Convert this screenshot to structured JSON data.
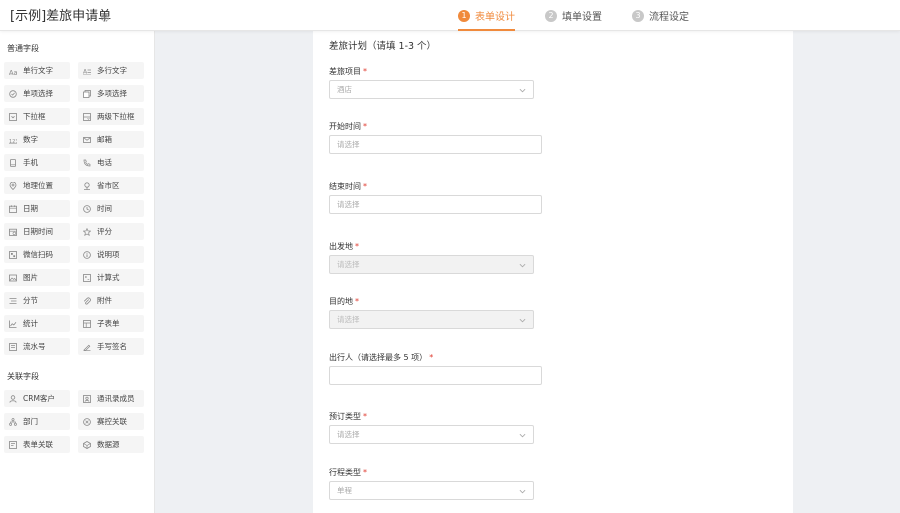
{
  "header": {
    "title": "[示例]差旅申请单",
    "steps": [
      {
        "num": "1",
        "label": "表单设计"
      },
      {
        "num": "2",
        "label": "填单设置"
      },
      {
        "num": "3",
        "label": "流程设定"
      }
    ],
    "active_step": 0,
    "accent_color": "#f08a3c"
  },
  "sidebar": {
    "common_title": "普通字段",
    "common": [
      {
        "label": "单行文字",
        "icon": "text-icon"
      },
      {
        "label": "多行文字",
        "icon": "multiline-text-icon"
      },
      {
        "label": "单项选择",
        "icon": "radio-icon"
      },
      {
        "label": "多项选择",
        "icon": "checkbox-icon"
      },
      {
        "label": "下拉框",
        "icon": "dropdown-icon"
      },
      {
        "label": "两级下拉框",
        "icon": "cascade-dropdown-icon"
      },
      {
        "label": "数字",
        "icon": "number-icon"
      },
      {
        "label": "邮箱",
        "icon": "mail-icon"
      },
      {
        "label": "手机",
        "icon": "mobile-icon"
      },
      {
        "label": "电话",
        "icon": "phone-icon"
      },
      {
        "label": "地理位置",
        "icon": "location-icon"
      },
      {
        "label": "省市区",
        "icon": "region-icon"
      },
      {
        "label": "日期",
        "icon": "calendar-icon"
      },
      {
        "label": "时间",
        "icon": "clock-icon"
      },
      {
        "label": "日期时间",
        "icon": "datetime-icon"
      },
      {
        "label": "评分",
        "icon": "star-icon"
      },
      {
        "label": "微信扫码",
        "icon": "qrcode-icon"
      },
      {
        "label": "说明项",
        "icon": "info-icon"
      },
      {
        "label": "图片",
        "icon": "image-icon"
      },
      {
        "label": "计算式",
        "icon": "formula-icon"
      },
      {
        "label": "分节",
        "icon": "section-icon"
      },
      {
        "label": "附件",
        "icon": "attachment-icon"
      },
      {
        "label": "统计",
        "icon": "chart-icon"
      },
      {
        "label": "子表单",
        "icon": "subform-icon"
      },
      {
        "label": "流水号",
        "icon": "serial-icon"
      },
      {
        "label": "手写签名",
        "icon": "signature-icon"
      }
    ],
    "related_title": "关联字段",
    "related": [
      {
        "label": "CRM客户",
        "icon": "customer-icon"
      },
      {
        "label": "通讯录成员",
        "icon": "contacts-icon"
      },
      {
        "label": "部门",
        "icon": "department-icon"
      },
      {
        "label": "赛控关联",
        "icon": "link-icon"
      },
      {
        "label": "表单关联",
        "icon": "form-link-icon"
      },
      {
        "label": "数据源",
        "icon": "datasource-icon"
      }
    ]
  },
  "form": {
    "title": "差旅计划（请填 1-3 个）",
    "fields": [
      {
        "label": "差旅项目",
        "type": "select",
        "value": "酒店",
        "disabled": false
      },
      {
        "label": "开始时间",
        "type": "input",
        "value": "请选择",
        "disabled": false
      },
      {
        "label": "结束时间",
        "type": "input",
        "value": "请选择",
        "disabled": false
      },
      {
        "label": "出发地",
        "type": "select",
        "value": "请选择",
        "disabled": true
      },
      {
        "label": "目的地",
        "type": "select",
        "value": "请选择",
        "disabled": true
      },
      {
        "label": "出行人（请选择最多 5 项）",
        "type": "input",
        "value": "",
        "disabled": false
      },
      {
        "label": "预订类型",
        "type": "select",
        "value": "请选择",
        "disabled": false
      },
      {
        "label": "行程类型",
        "type": "select",
        "value": "单程",
        "disabled": false
      }
    ]
  }
}
